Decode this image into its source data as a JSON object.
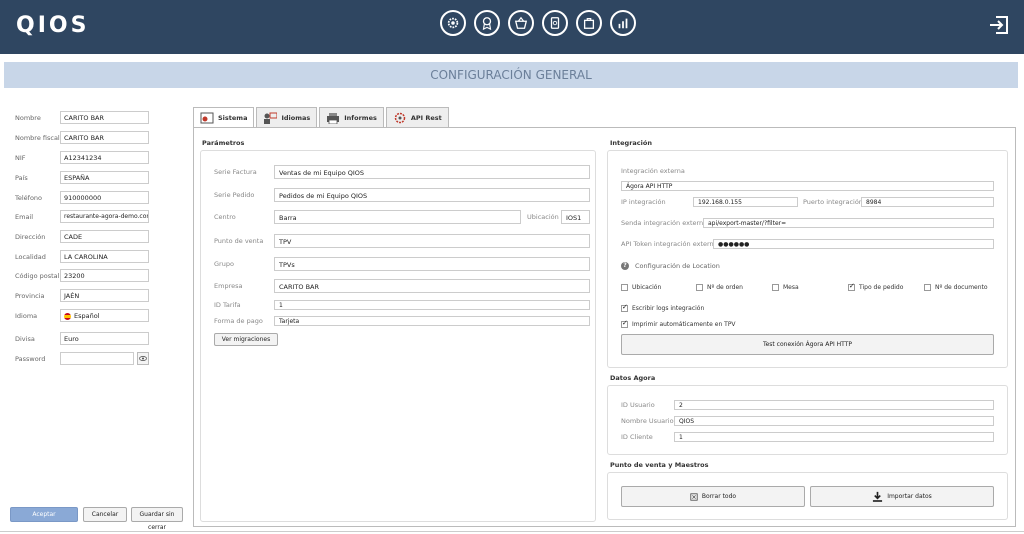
{
  "app": {
    "logo": "QIOS",
    "title": "CONFIGURACIÓN GENERAL"
  },
  "top_icons": [
    "gear-icon",
    "badge-icon",
    "basket-icon",
    "tablet-icon",
    "bag-icon",
    "chart-icon"
  ],
  "left_form": {
    "fields": [
      {
        "label": "Nombre",
        "value": "CARITO BAR"
      },
      {
        "label": "Nombre fiscal",
        "value": "CARITO BAR"
      },
      {
        "label": "NIF",
        "value": "A12341234"
      },
      {
        "label": "País",
        "value": "ESPAÑA"
      },
      {
        "label": "Teléfono",
        "value": "910000000"
      },
      {
        "label": "Email",
        "value": "restaurante-agora-demo.com"
      },
      {
        "label": "Dirección",
        "value": "CADE"
      },
      {
        "label": "Localidad",
        "value": "LA CAROLINA"
      },
      {
        "label": "Código postal",
        "value": "23200"
      },
      {
        "label": "Provincia",
        "value": "JAÉN"
      },
      {
        "label": "Idioma",
        "value": "Español"
      },
      {
        "label": "Divisa",
        "value": "Euro"
      },
      {
        "label": "Password",
        "value": ""
      }
    ],
    "buttons": {
      "accept": "Aceptar",
      "cancel": "Cancelar",
      "save": "Guardar sin cerrar"
    }
  },
  "tabs": [
    {
      "label": "Sistema",
      "active": true
    },
    {
      "label": "Idiomas",
      "active": false
    },
    {
      "label": "Informes",
      "active": false
    },
    {
      "label": "API Rest",
      "active": false
    }
  ],
  "parametros": {
    "title": "Parámetros",
    "serie_factura": {
      "label": "Serie Factura",
      "value": "Ventas de mi Equipo QIOS"
    },
    "serie_pedido": {
      "label": "Serie Pedido",
      "value": "Pedidos de mi Equipo QIOS"
    },
    "centro": {
      "label": "Centro",
      "value": "Barra"
    },
    "ubicacion": {
      "label": "Ubicación",
      "value": "IOS1"
    },
    "punto_venta": {
      "label": "Punto de venta",
      "value": "TPV"
    },
    "grupo": {
      "label": "Grupo",
      "value": "TPVs"
    },
    "empresa": {
      "label": "Empresa",
      "value": "CARITO BAR"
    },
    "id_tarifa": {
      "label": "ID Tarifa",
      "value": "1"
    },
    "forma_pago": {
      "label": "Forma de pago",
      "value": "Tarjeta"
    },
    "ver_migraciones": "Ver migraciones"
  },
  "integracion": {
    "title": "Integración",
    "externa_label": "Integración externa",
    "externa_value": "Ágora API HTTP",
    "ip_label": "IP integración",
    "ip_value": "192.168.0.155",
    "puerto_label": "Puerto integración",
    "puerto_value": "8984",
    "senda_label": "Senda integración externa",
    "senda_value": "api/export-master/?filter=",
    "token_label": "API Token integración externa",
    "token_value": "●●●●●●",
    "location_label": "Configuración de Location",
    "location_checks": [
      {
        "label": "Ubicación",
        "checked": false
      },
      {
        "label": "Nº de orden",
        "checked": false
      },
      {
        "label": "Mesa",
        "checked": false
      },
      {
        "label": "Tipo de pedido",
        "checked": true
      },
      {
        "label": "Nº de documento",
        "checked": false
      }
    ],
    "escribir_logs": {
      "label": "Escribir logs integración",
      "checked": true
    },
    "imprimir_auto": {
      "label": "Imprimir automáticamente en TPV",
      "checked": true
    },
    "test_button": "Test conexión Ágora API HTTP"
  },
  "datos_agora": {
    "title": "Datos Agora",
    "id_usuario": {
      "label": "ID Usuario",
      "value": "2"
    },
    "nombre_usuario": {
      "label": "Nombre Usuario",
      "value": "QIOS"
    },
    "id_cliente": {
      "label": "ID Cliente",
      "value": "1"
    }
  },
  "maestros": {
    "title": "Punto de venta y Maestros",
    "borrar": "Borrar todo",
    "importar": "Importar datos"
  }
}
